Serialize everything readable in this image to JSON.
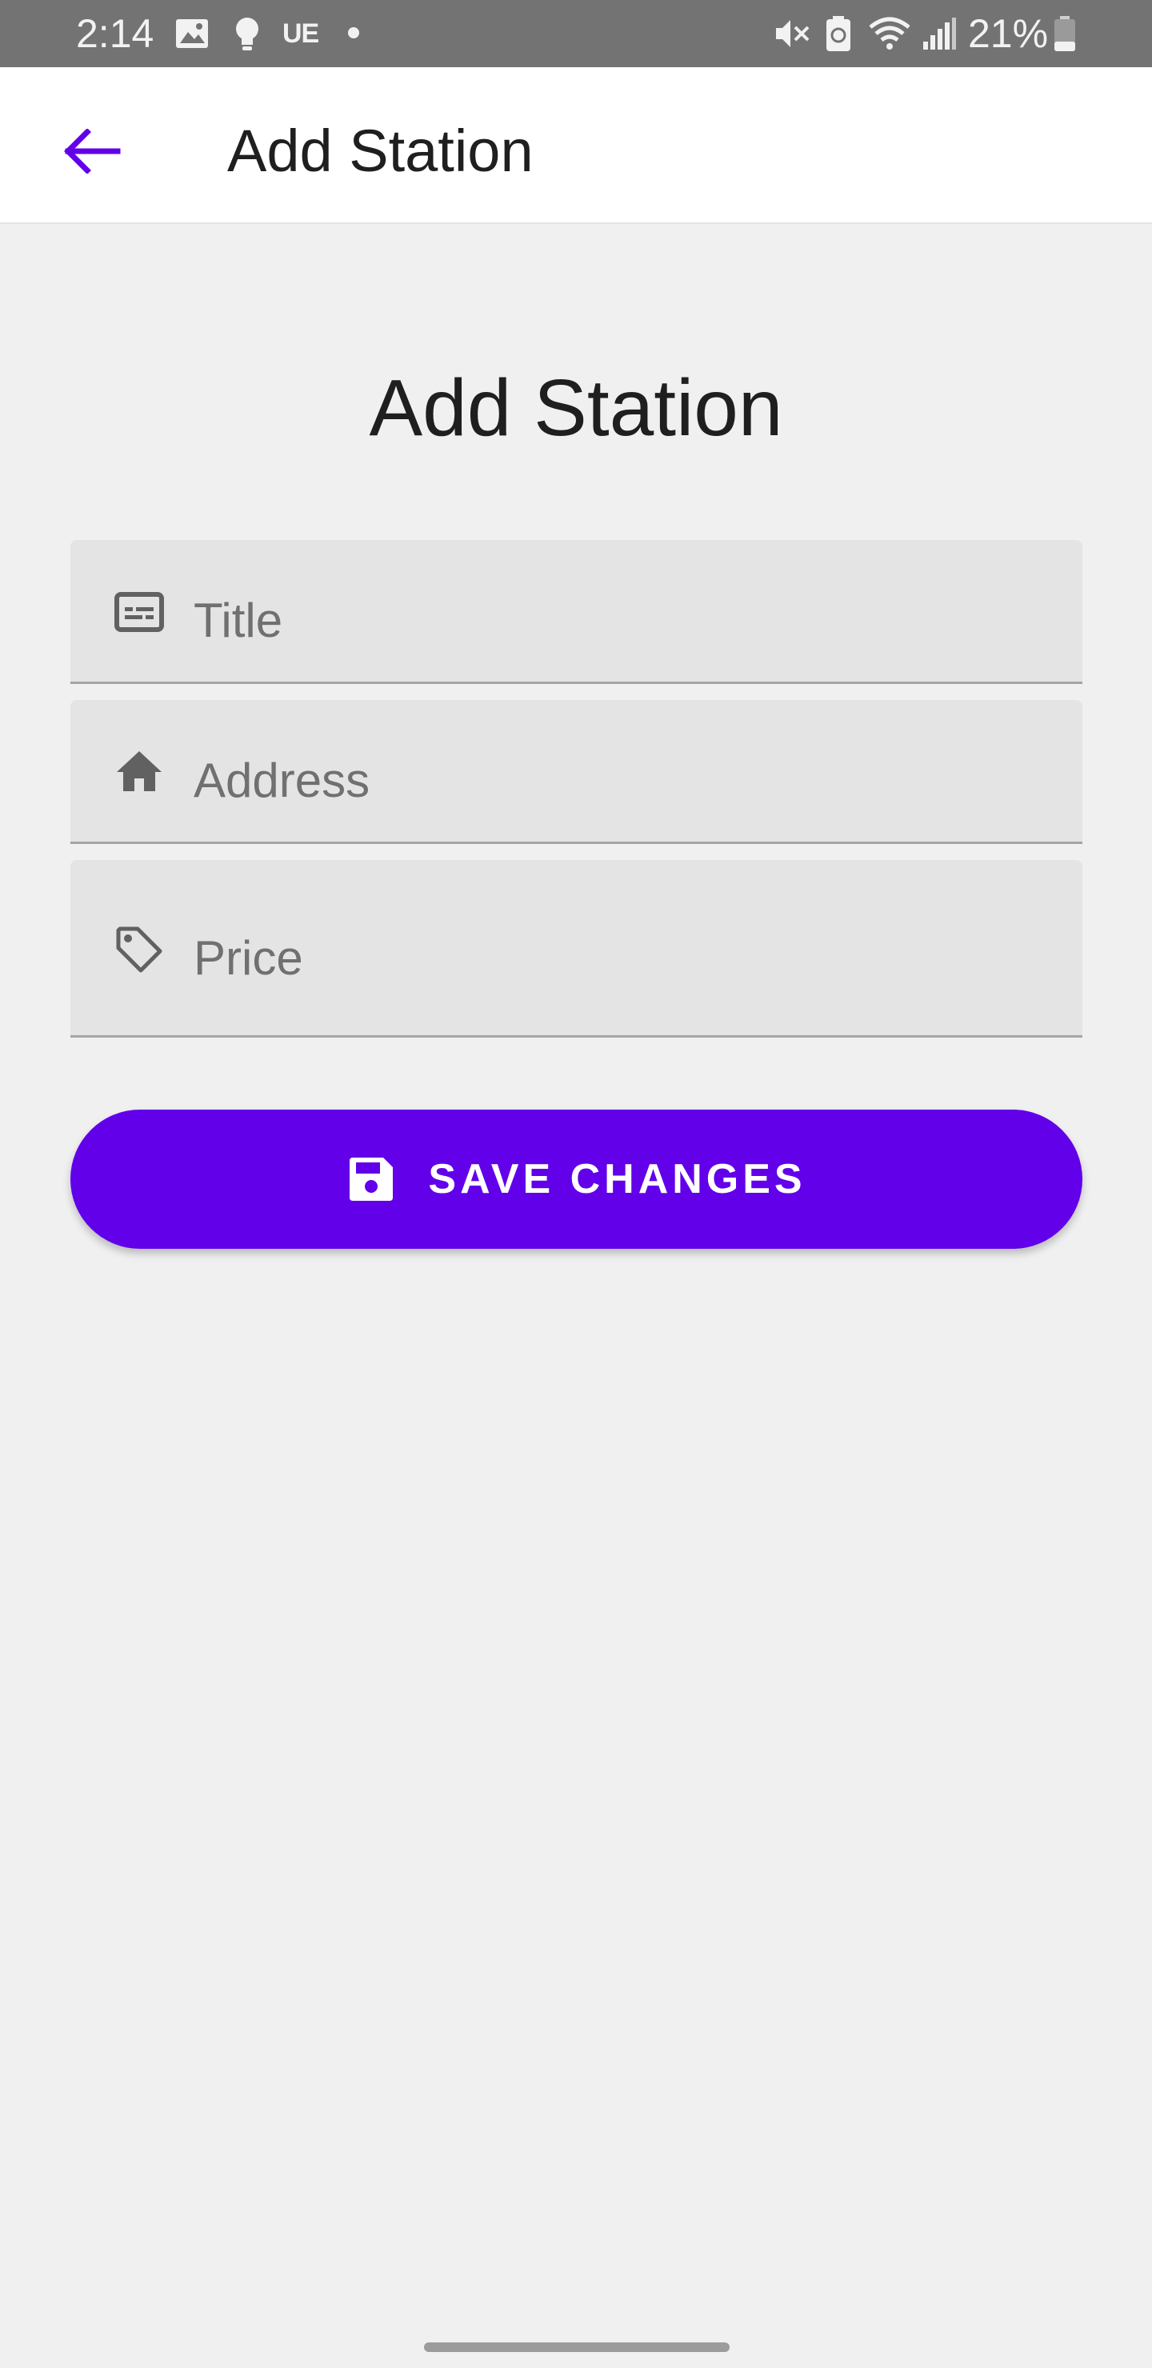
{
  "status_bar": {
    "time": "2:14",
    "carrier": "UE",
    "battery_percent": "21%",
    "icons": [
      "image-icon",
      "bulb-icon",
      "dot-icon",
      "mute-icon",
      "battery-saver-icon",
      "wifi-icon",
      "signal-icon",
      "battery-icon"
    ]
  },
  "app_bar": {
    "title": "Add Station",
    "back_icon": "arrow-left-icon"
  },
  "page": {
    "heading": "Add Station"
  },
  "form": {
    "title": {
      "placeholder": "Title",
      "value": "",
      "icon": "subtitles-icon"
    },
    "address": {
      "placeholder": "Address",
      "value": "",
      "icon": "home-icon"
    },
    "price": {
      "placeholder": "Price",
      "value": "",
      "icon": "tag-icon"
    }
  },
  "save_button": {
    "label": "SAVE CHANGES",
    "icon": "save-icon"
  },
  "colors": {
    "accent": "#6200ea",
    "status_bar": "#737373",
    "background": "#f0f0f1",
    "field_background": "#e4e4e5"
  }
}
